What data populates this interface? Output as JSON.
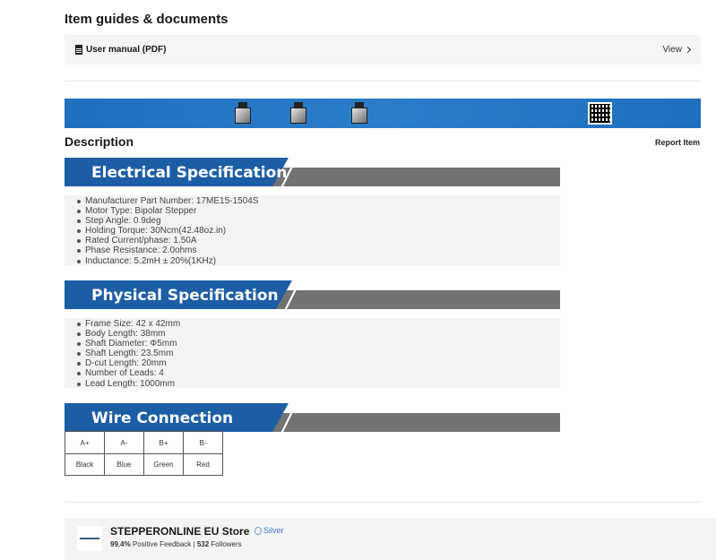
{
  "guides": {
    "title": "Item guides & documents",
    "doc_label": "User manual (PDF)",
    "view_label": "View"
  },
  "description": {
    "title": "Description",
    "report_label": "Report Item"
  },
  "electrical": {
    "title": "Electrical Specification",
    "items": [
      "Manufacturer Part Number: 17ME15-1504S",
      "Motor Type: Bipolar Stepper",
      "Step Angle: 0.9deg",
      "Holding Torque: 30Ncm(42.48oz.in)",
      "Rated Current/phase: 1.50A",
      "Phase Resistance: 2.0ohms",
      "Inductance: 5.2mH ± 20%(1KHz)"
    ]
  },
  "physical": {
    "title": "Physical Specification",
    "items": [
      "Frame Size: 42 x 42mm",
      "Body Length: 38mm",
      "Shaft Diameter: Φ5mm",
      "Shaft Length: 23.5mm",
      "D-cut Length: 20mm",
      "Number of Leads: 4",
      "Lead Length: 1000mm"
    ]
  },
  "wire": {
    "title": "Wire Connection",
    "headers": [
      "A+",
      "A-",
      "B+",
      "B-"
    ],
    "colors": [
      "Black",
      "Blue",
      "Green",
      "Red"
    ]
  },
  "store": {
    "name": "STEPPERONLINE EU Store",
    "badge": "Silver",
    "feedback_pct": "99.4%",
    "feedback_label": "Positive Feedback |",
    "followers": "532",
    "followers_label": "Followers"
  },
  "colors": {
    "banner_blue": "#1f6fbe",
    "header_blue": "#1c5ea6",
    "header_gray": "#737373",
    "badge_blue": "#3a7cc8"
  }
}
